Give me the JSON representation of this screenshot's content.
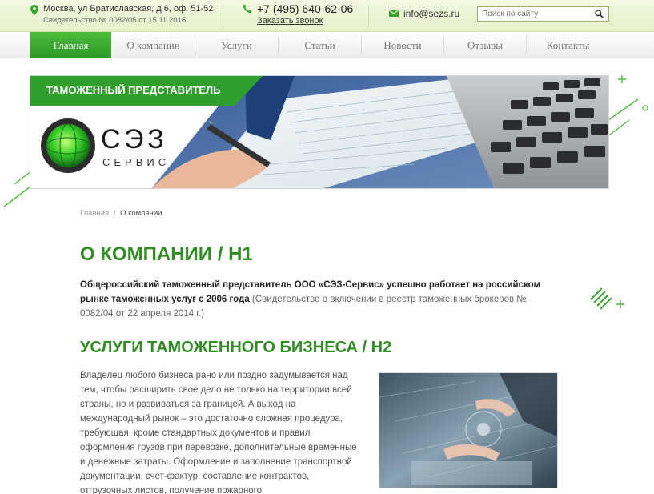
{
  "header": {
    "address": "Москва, ул Братиславская, д 6, оф. 51-52",
    "certificate": "Свидетельство № 0082/05 от 15.11.2016",
    "phone": "+7 (495) 640-62-06",
    "callback": "Заказать звонок",
    "email": "info@sezs.ru",
    "search_placeholder": "Поиск по сайту"
  },
  "nav": [
    {
      "label": "Главная",
      "active": true
    },
    {
      "label": "О компании",
      "active": false
    },
    {
      "label": "Услуги",
      "active": false
    },
    {
      "label": "Статьи",
      "active": false
    },
    {
      "label": "Новости",
      "active": false
    },
    {
      "label": "Отзывы",
      "active": false
    },
    {
      "label": "Контакты",
      "active": false
    }
  ],
  "banner": {
    "tag": "ТАМОЖЕННЫЙ ПРЕДСТАВИТЕЛЬ",
    "brand_main": "СЭЗ",
    "brand_sub": "СЕРВИС"
  },
  "breadcrumb": {
    "home": "Главная",
    "separator": "/",
    "current": "О компании"
  },
  "content": {
    "h1": "О КОМПАНИИ / H1",
    "intro_bold": "Общероссийский таможенный представитель ООО «СЭЗ-Сервис» успешно работает на российском рынке таможенных услуг с 2006 года",
    "intro_rest": " (Свидетельство о включении в реестр таможенных брокеров № 0082/04 от 22 апреля 2014 г.)",
    "h2": "УСЛУГИ ТАМОЖЕННОГО БИЗНЕСА / H2",
    "paragraph": "Владелец любого бизнеса рано или поздно задумывается над тем, чтобы расширить свое дело не только на территории всей страны, но и развиваться за границей. А выход на международный рынок – это достаточно сложная процедура, требующая, кроме стандартных документов и правил оформления грузов при перевозке, дополнительные временные и денежные затраты. Оформление и заполнение транспортной документации, счет-фактур, составление контрактов, отгрузочных листов, получение пожарного"
  },
  "colors": {
    "accent": "#2f9e2a",
    "heading": "#2f8f22",
    "topbar": "#e6f1c8"
  }
}
